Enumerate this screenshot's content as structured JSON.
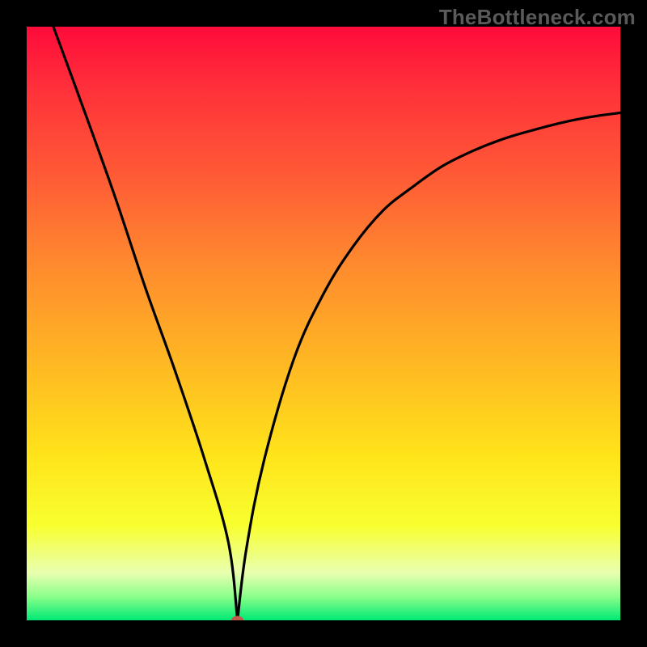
{
  "watermark": "TheBottleneck.com",
  "chart_data": {
    "type": "line",
    "title": "",
    "xlabel": "",
    "ylabel": "",
    "xlim": [
      0,
      100
    ],
    "ylim": [
      0,
      100
    ],
    "grid": false,
    "legend": false,
    "series": [
      {
        "name": "curve",
        "x": [
          4.5,
          10,
          15,
          20,
          25,
          30,
          34,
          35.5,
          37,
          40,
          45,
          50,
          55,
          60,
          65,
          70,
          75,
          80,
          85,
          90,
          95,
          100
        ],
        "values": [
          100,
          85,
          71,
          56,
          42,
          27,
          13,
          0,
          12,
          27,
          44,
          55,
          63,
          69,
          73,
          76.5,
          79,
          81,
          82.5,
          83.8,
          84.8,
          85.5
        ]
      }
    ],
    "min_marker": {
      "x": 35.5,
      "y": 0
    },
    "background_gradient": {
      "top": "#ff0b3a",
      "mid": "#ffe31a",
      "bottom": "#00e874"
    }
  }
}
